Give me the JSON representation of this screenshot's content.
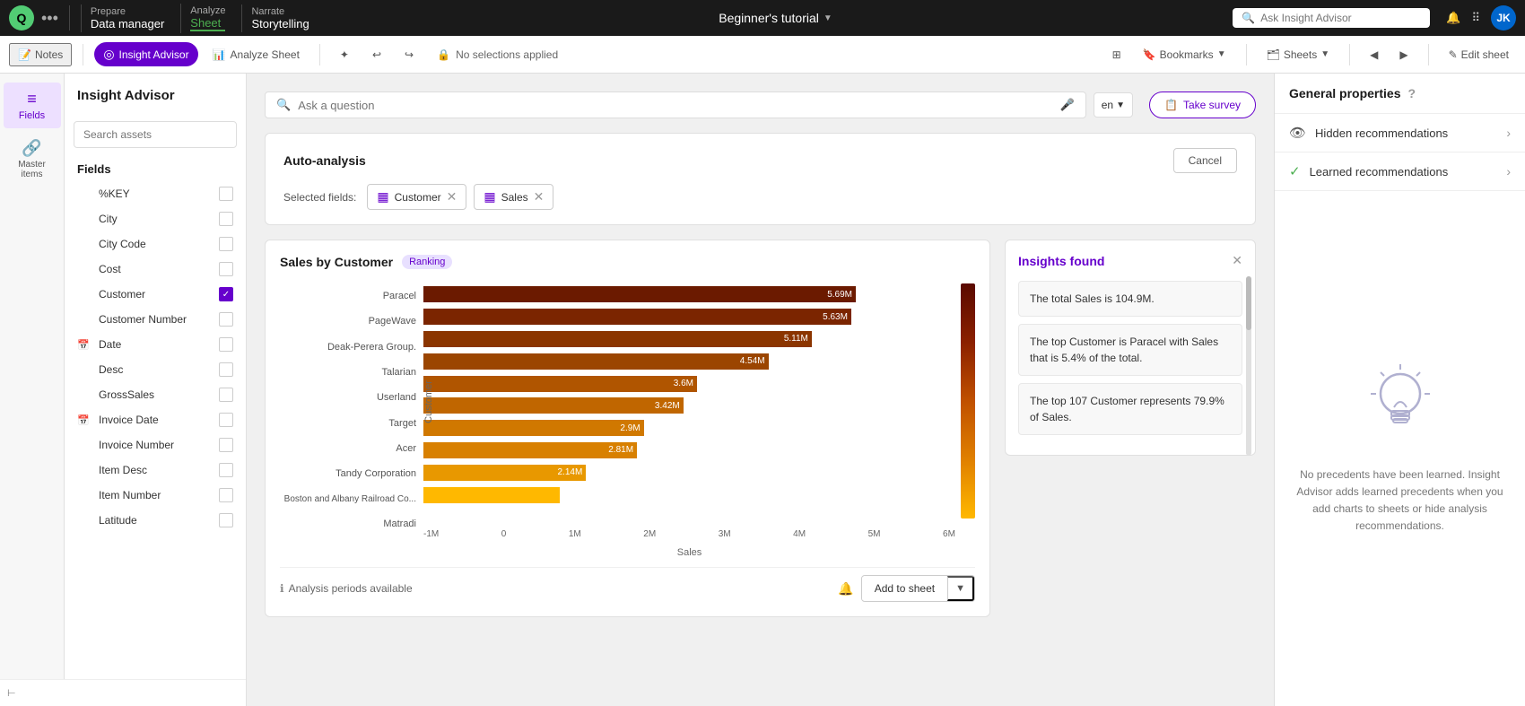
{
  "topnav": {
    "logo_letter": "Q",
    "app_title": "Beginner's tutorial",
    "sections": [
      {
        "label": "Prepare",
        "title": "Data manager"
      },
      {
        "label": "Analyze",
        "title": "Sheet",
        "active": true
      },
      {
        "label": "Narrate",
        "title": "Storytelling"
      }
    ],
    "search_placeholder": "Ask Insight Advisor",
    "avatar_initials": "JK"
  },
  "toolbar2": {
    "notes_label": "Notes",
    "insight_advisor_label": "Insight Advisor",
    "analyze_sheet_label": "Analyze Sheet",
    "no_selections_label": "No selections applied",
    "bookmarks_label": "Bookmarks",
    "sheets_label": "Sheets",
    "edit_sheet_label": "Edit sheet"
  },
  "left_sidebar": {
    "panel_title": "Insight Advisor",
    "fields_icon_label": "Fields",
    "master_items_icon_label": "Master items",
    "search_placeholder": "Search assets",
    "fields_section_title": "Fields",
    "fields": [
      {
        "name": "%KEY",
        "type": "text",
        "checked": false
      },
      {
        "name": "City",
        "type": "text",
        "checked": false
      },
      {
        "name": "City Code",
        "type": "text",
        "checked": false
      },
      {
        "name": "Cost",
        "type": "text",
        "checked": false
      },
      {
        "name": "Customer",
        "type": "text",
        "checked": true
      },
      {
        "name": "Customer Number",
        "type": "text",
        "checked": false
      },
      {
        "name": "Date",
        "type": "calendar",
        "checked": false
      },
      {
        "name": "Desc",
        "type": "text",
        "checked": false
      },
      {
        "name": "GrossSales",
        "type": "text",
        "checked": false
      },
      {
        "name": "Invoice Date",
        "type": "calendar",
        "checked": false
      },
      {
        "name": "Invoice Number",
        "type": "text",
        "checked": false
      },
      {
        "name": "Item Desc",
        "type": "text",
        "checked": false
      },
      {
        "name": "Item Number",
        "type": "text",
        "checked": false
      },
      {
        "name": "Latitude",
        "type": "text",
        "checked": false
      }
    ]
  },
  "insight_search": {
    "placeholder": "Ask a question",
    "lang": "en",
    "take_survey_label": "Take survey"
  },
  "auto_analysis": {
    "title": "Auto-analysis",
    "cancel_label": "Cancel",
    "selected_fields_label": "Selected fields:",
    "fields": [
      {
        "name": "Customer",
        "icon": "table"
      },
      {
        "name": "Sales",
        "icon": "table"
      }
    ]
  },
  "chart": {
    "title": "Sales by Customer",
    "badge": "Ranking",
    "bars": [
      {
        "label": "Paracel",
        "value": 5.69,
        "value_label": "5.69M",
        "color": "#6B1A00",
        "pct": 100
      },
      {
        "label": "PageWave",
        "value": 5.63,
        "value_label": "5.63M",
        "color": "#7B2500",
        "pct": 99
      },
      {
        "label": "Deak-Perera Group.",
        "value": 5.11,
        "value_label": "5.11M",
        "color": "#8B3500",
        "pct": 90
      },
      {
        "label": "Talarian",
        "value": 4.54,
        "value_label": "4.54M",
        "color": "#9B4500",
        "pct": 80
      },
      {
        "label": "Userland",
        "value": 3.6,
        "value_label": "3.6M",
        "color": "#B05500",
        "pct": 63
      },
      {
        "label": "Target",
        "value": 3.42,
        "value_label": "3.42M",
        "color": "#C06600",
        "pct": 60
      },
      {
        "label": "Acer",
        "value": 2.9,
        "value_label": "2.9M",
        "color": "#D07800",
        "pct": 51
      },
      {
        "label": "Tandy Corporation",
        "value": 2.81,
        "value_label": "2.81M",
        "color": "#E08A00",
        "pct": 49
      },
      {
        "label": "Boston and Albany Railroad Co...",
        "value": 2.14,
        "value_label": "2.14M",
        "color": "#F0A000",
        "pct": 38
      },
      {
        "label": "Matradi",
        "value": 1.8,
        "value_label": "",
        "color": "#FFBB00",
        "pct": 32
      }
    ],
    "x_axis_labels": [
      "-1M",
      "0",
      "1M",
      "2M",
      "3M",
      "4M",
      "5M",
      "6M"
    ],
    "x_axis_title": "Sales",
    "y_axis_title": "Customer",
    "analysis_periods_label": "Analysis periods available",
    "add_to_sheet_label": "Add to sheet"
  },
  "insights": {
    "title": "Insights found",
    "items": [
      "The total Sales is 104.9M.",
      "The top Customer is Paracel with Sales that is 5.4% of the total.",
      "The top 107 Customer represents 79.9% of Sales."
    ]
  },
  "right_panel": {
    "title": "General properties",
    "sections": [
      {
        "icon": "eye-off",
        "label": "Hidden recommendations"
      },
      {
        "icon": "check-circle",
        "label": "Learned recommendations"
      }
    ],
    "lightbulb_text": "No precedents have been learned. Insight Advisor adds learned precedents when you add charts to sheets or hide analysis recommendations."
  }
}
